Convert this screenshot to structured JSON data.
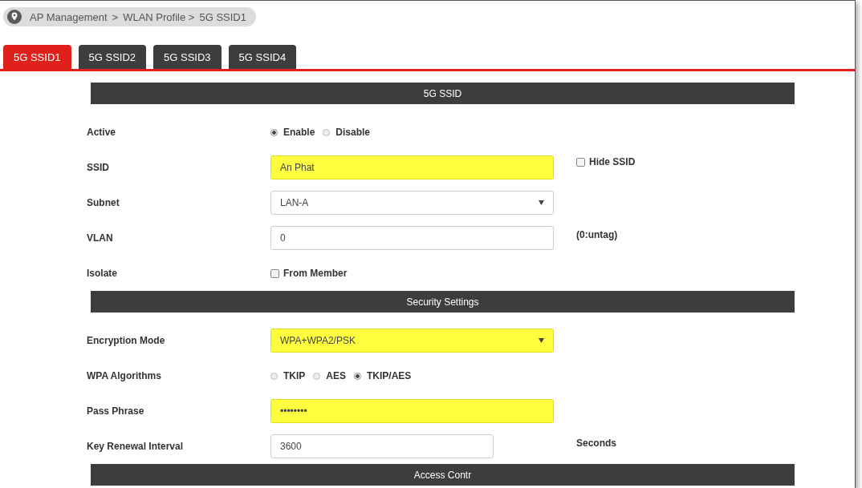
{
  "breadcrumb": [
    "AP Management",
    ">",
    "WLAN Profile >",
    "5G SSID1"
  ],
  "tabs": [
    {
      "label": "5G SSID1",
      "selected": true
    },
    {
      "label": "5G SSID2",
      "selected": false
    },
    {
      "label": "5G SSID3",
      "selected": false
    },
    {
      "label": "5G SSID4",
      "selected": false
    }
  ],
  "sections": [
    {
      "title": "5G SSID",
      "rows": [
        {
          "label": "Active",
          "kind": "radio",
          "options": [
            {
              "label": "Enable",
              "selected": true
            },
            {
              "label": "Disable",
              "selected": false
            }
          ]
        },
        {
          "label": "SSID",
          "kind": "text",
          "value": "An Phat",
          "highlighted": true,
          "side_checkbox": {
            "label": "Hide SSID",
            "checked": false
          }
        },
        {
          "label": "Subnet",
          "kind": "select",
          "value": "LAN-A",
          "highlighted": false
        },
        {
          "label": "VLAN",
          "kind": "text",
          "value": "0",
          "highlighted": false,
          "note": "(0:untag)"
        },
        {
          "label": "Isolate",
          "kind": "checkbox",
          "checkbox": {
            "label": "From Member",
            "checked": false
          }
        }
      ]
    },
    {
      "title": "Security Settings",
      "rows": [
        {
          "label": "Encryption Mode",
          "kind": "select",
          "value": "WPA+WPA2/PSK",
          "highlighted": true
        },
        {
          "label": "WPA Algorithms",
          "kind": "radio",
          "options": [
            {
              "label": "TKIP",
              "selected": false
            },
            {
              "label": "AES",
              "selected": false
            },
            {
              "label": "TKIP/AES",
              "selected": true
            }
          ]
        },
        {
          "label": "Pass Phrase",
          "kind": "text",
          "value": "••••••••",
          "highlighted": true
        },
        {
          "label": "Key Renewal Interval",
          "kind": "number",
          "value": "3600",
          "highlighted": false,
          "note": "Seconds"
        }
      ]
    },
    {
      "title": "Access Contr"
    }
  ]
}
